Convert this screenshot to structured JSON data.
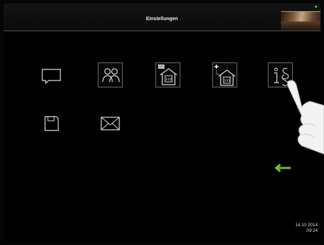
{
  "header": {
    "title": "Einstellungen",
    "status_color": "#3ecf3e"
  },
  "tiles": [
    {
      "icon": "speech-bubble-icon"
    },
    {
      "icon": "users-icon"
    },
    {
      "icon": "house-heating-list-icon"
    },
    {
      "icon": "house-heating-add-icon"
    },
    {
      "icon": "info-legal-icon"
    },
    {
      "icon": "floppy-disk-icon"
    },
    {
      "icon": "envelope-icon"
    }
  ],
  "back": {
    "icon": "back-arrow-icon",
    "color": "#6fbf3a"
  },
  "footer": {
    "date": "14.10.2014",
    "time": "09:24"
  }
}
